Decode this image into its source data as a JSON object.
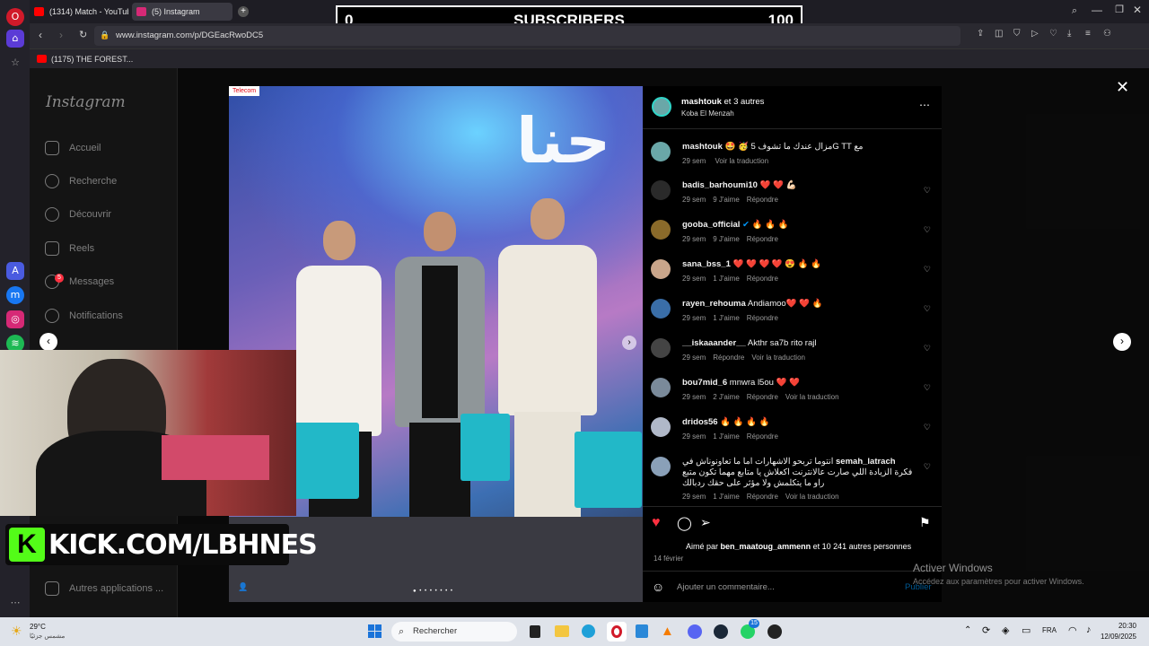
{
  "overlay_banner": {
    "left": "0",
    "title": "SUBSCRIBERS",
    "right": "100"
  },
  "tabs": [
    {
      "label": "(1314) Match - YouTube"
    },
    {
      "label": "(5) Instagram"
    }
  ],
  "address": {
    "url": "www.instagram.com/p/DGEacRwoDC5"
  },
  "bookmarks": [
    {
      "label": "(1175) THE FOREST..."
    }
  ],
  "instagram": {
    "logo": "Instagram",
    "nav": [
      {
        "label": "Accueil"
      },
      {
        "label": "Recherche"
      },
      {
        "label": "Découvrir"
      },
      {
        "label": "Reels"
      },
      {
        "label": "Messages",
        "badge": "5"
      },
      {
        "label": "Notifications"
      }
    ],
    "other_apps": "Autres applications ...",
    "post": {
      "author": "mashtouk",
      "coauthors": "et 3 autres",
      "location": "Koba El Menzah",
      "photo_caption_text": "Telecom"
    },
    "caption": {
      "user": "mashtouk",
      "text": "🤩 🥳 مزال عندك ما تشوف 5G TT مع",
      "age": "29 sem",
      "translate": "Voir la traduction"
    },
    "comments": [
      {
        "user": "badis_barhoumi10",
        "text": "❤️ ❤️ 💪🏻",
        "age": "29 sem",
        "likes": "9 J'aime",
        "reply": "Répondre",
        "translate": "",
        "color": "#2a2a2a"
      },
      {
        "user": "gooba_official",
        "text": "🔥 🔥 🔥",
        "verified": true,
        "age": "29 sem",
        "likes": "9 J'aime",
        "reply": "Répondre",
        "translate": "",
        "color": "#8a6a2a"
      },
      {
        "user": "sana_bss_1",
        "text": "❤️ ❤️ ❤️ ❤️ 😍 🔥 🔥",
        "age": "29 sem",
        "likes": "1 J'aime",
        "reply": "Répondre",
        "translate": "",
        "color": "#c9a58a"
      },
      {
        "user": "rayen_rehouma",
        "text": "Andiamoo❤️ ❤️ 🔥",
        "age": "29 sem",
        "likes": "1 J'aime",
        "reply": "Répondre",
        "translate": "",
        "color": "#3a6ea8"
      },
      {
        "user": "__iskaaander__",
        "text": "Akthr sa7b rito rajl",
        "age": "29 sem",
        "likes": "",
        "reply": "Répondre",
        "translate": "Voir la traduction",
        "color": "#444"
      },
      {
        "user": "bou7mid_6",
        "text": "mnwra l5ou ❤️ ❤️",
        "age": "29 sem",
        "likes": "2 J'aime",
        "reply": "Répondre",
        "translate": "Voir la traduction",
        "color": "#7a8a9a"
      },
      {
        "user": "dridos56",
        "text": "🔥 🔥 🔥 🔥",
        "age": "29 sem",
        "likes": "1 J'aime",
        "reply": "Répondre",
        "translate": "",
        "color": "#b0b8c8"
      },
      {
        "user": "semah_latrach",
        "text": "انتوما تربحو الاشهارات اما ما تعاونوناش في فكرة الزيادة اللي صارت عالانترنت اكعلاش يا متابع مهما تكون متبع راو ما يتكلمش ولا مؤثر على حقك ردبالك",
        "age": "29 sem",
        "likes": "1 J'aime",
        "reply": "Répondre",
        "translate": "Voir la traduction",
        "color": "#8aa0b8"
      }
    ],
    "liked_by": {
      "prefix": "Aimé par",
      "user": "ben_maatoug_ammenn",
      "suffix": "et 10 241 autres personnes"
    },
    "date": "14 février",
    "add_comment_placeholder": "Ajouter un commentaire...",
    "publish": "Publier"
  },
  "watermark": {
    "line1": "Activer Windows",
    "line2": "Accédez aux paramètres pour activer Windows."
  },
  "stream_overlay": {
    "kick": "KICK.COM/LBHNES"
  },
  "taskbar": {
    "weather_temp": "29°C",
    "weather_desc": "مشمس جزئيًا",
    "search": "Rechercher",
    "lang": "FRA",
    "time": "20:30",
    "date": "12/09/2025",
    "badge_count": "15"
  },
  "colors": {
    "accent_red": "#ff3040",
    "kick_green": "#53fc18",
    "link_blue": "#0095f6"
  }
}
